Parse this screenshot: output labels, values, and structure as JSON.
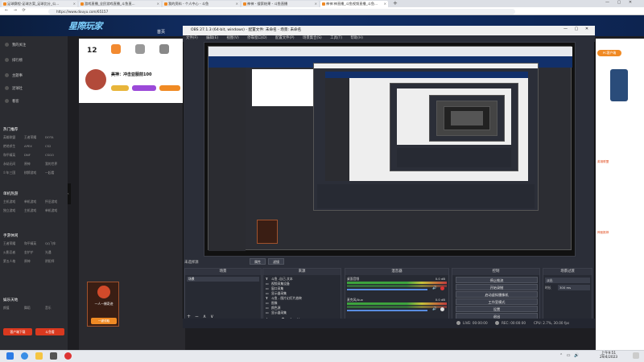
{
  "browser": {
    "tabs": [
      {
        "label": "足球赛程-足球方案_足球比分_公..."
      },
      {
        "label": "游戏直播_全民游戏直播_斗鱼直..."
      },
      {
        "label": "我的资料 - 个人中心 - 斗鱼"
      },
      {
        "label": "神神 - 搜索结果 - 斗鱼直播"
      },
      {
        "label": "神神:神直播_斗鱼视频直播_斗鱼..."
      }
    ],
    "url": "https://www.douyu.com/65157"
  },
  "douyu": {
    "logo": "星際玩家",
    "nav_home": "首页",
    "room_title": "美神：冲击亚服前100",
    "follow_count": "12",
    "promo_title": "一人一棵奇迹",
    "promo_button": "一键领取"
  },
  "sidebar": {
    "items": [
      "我的关注",
      "排行榜",
      "主题事",
      "足球社",
      "看客"
    ],
    "sections": [
      {
        "head": "热门推荐",
        "entries": [
          "英雄联盟",
          "王者荣耀",
          "DOTA",
          "绝地求生",
          "APEX",
          "CS2",
          "和平精英",
          "DNF",
          "CSGO",
          "永劫无间",
          "原神",
          "我的世界",
          "少年三国",
          "棋牌游戏",
          "一起看",
          "炉石传说",
          "魔兽",
          "星际"
        ]
      },
      {
        "head": "单机热游",
        "entries": [
          "主机游戏",
          "单机游戏",
          "怀旧游戏",
          "独立游戏",
          "主机游戏",
          "单机游戏"
        ]
      },
      {
        "head": "手游休闲",
        "entries": [
          "王者荣耀",
          "和平精英",
          "QQ飞车",
          "火影忍者",
          "金铲铲",
          "光遇",
          "第五人格",
          "原神",
          "阴阳师"
        ]
      },
      {
        "head": "娱乐天地",
        "entries": [
          "颜值",
          "舞蹈",
          "音乐"
        ]
      }
    ],
    "bottom_buttons": [
      "客户端下载",
      "斗鱼看"
    ]
  },
  "obs": {
    "title": "OBS 27.1.3 (64-bit, windows) - 配置文件: 未命名 - 场景: 未命名",
    "menu": [
      "文件(F)",
      "编辑(E)",
      "视图(V)",
      "停靠窗口(D)",
      "配置文件(P)",
      "场景集合(S)",
      "工具(T)",
      "帮助(H)"
    ],
    "scene_label": "未选择源",
    "toolbar_buttons": [
      "属性",
      "滤镜"
    ],
    "panels": {
      "scenes": "场景",
      "sources": "来源",
      "mixer": "混音器",
      "transitions": "场景过渡",
      "controls": "控制"
    },
    "scene_items": [
      "场景"
    ],
    "source_items": [
      "斗鱼 -自己-文本",
      "视频采集设备",
      "窗口采集",
      "显示器采集",
      "斗鱼 - 图片幻灯片放映",
      "图像",
      "颜色源",
      "显示器采集"
    ],
    "mixer_tracks": [
      {
        "name": "桌面音频",
        "level": "0.0 dB"
      },
      {
        "name": "麦克风/Aux",
        "level": "0.0 dB"
      }
    ],
    "transition": {
      "type": "淡出",
      "duration_label": "时长",
      "duration": "300 ms"
    },
    "controls": [
      "停止推流",
      "开始录制",
      "启动虚拟摄像机",
      "工作室模式",
      "设置",
      "退出"
    ],
    "status": {
      "live": "LIVE: 00:00:00",
      "rec": "REC: 00:00:00",
      "cpu": "CPU: 2.7%, 30.00 fps"
    }
  },
  "right_panel": {
    "badge": "PC客户端",
    "texts": [
      "英雄联盟",
      "神医推荐"
    ]
  },
  "taskbar": {
    "time": "上午9:51",
    "date": "29/4/2023"
  }
}
